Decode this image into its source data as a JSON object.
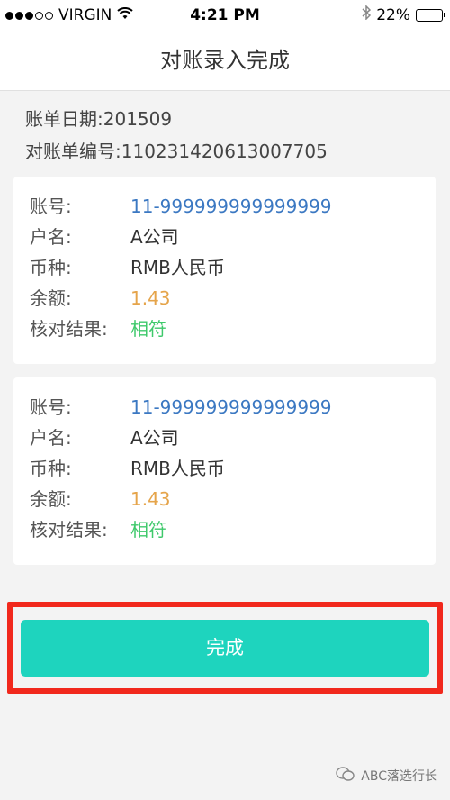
{
  "status_bar": {
    "carrier": "VIRGIN",
    "time": "4:21 PM",
    "battery": "22%"
  },
  "nav": {
    "title": "对账录入完成"
  },
  "summary": {
    "bill_date_label": "账单日期:",
    "bill_date_value": "201509",
    "statement_no_label": "对账单编号:",
    "statement_no_value": "110231420613007705"
  },
  "cards": [
    {
      "account_label": "账号:",
      "account_value": "11-999999999999999",
      "name_label": "户名:",
      "name_value": "A公司",
      "currency_label": "币种:",
      "currency_value": "RMB人民币",
      "balance_label": "余额:",
      "balance_value": "1.43",
      "result_label": "核对结果:",
      "result_value": "相符"
    },
    {
      "account_label": "账号:",
      "account_value": "11-999999999999999",
      "name_label": "户名:",
      "name_value": "A公司",
      "currency_label": "币种:",
      "currency_value": "RMB人民币",
      "balance_label": "余额:",
      "balance_value": "1.43",
      "result_label": "核对结果:",
      "result_value": "相符"
    }
  ],
  "done_button": {
    "label": "完成",
    "color": "#1ed4be"
  },
  "highlight_color": "#f1281c",
  "watermark": {
    "text": "ABC落选行长"
  }
}
